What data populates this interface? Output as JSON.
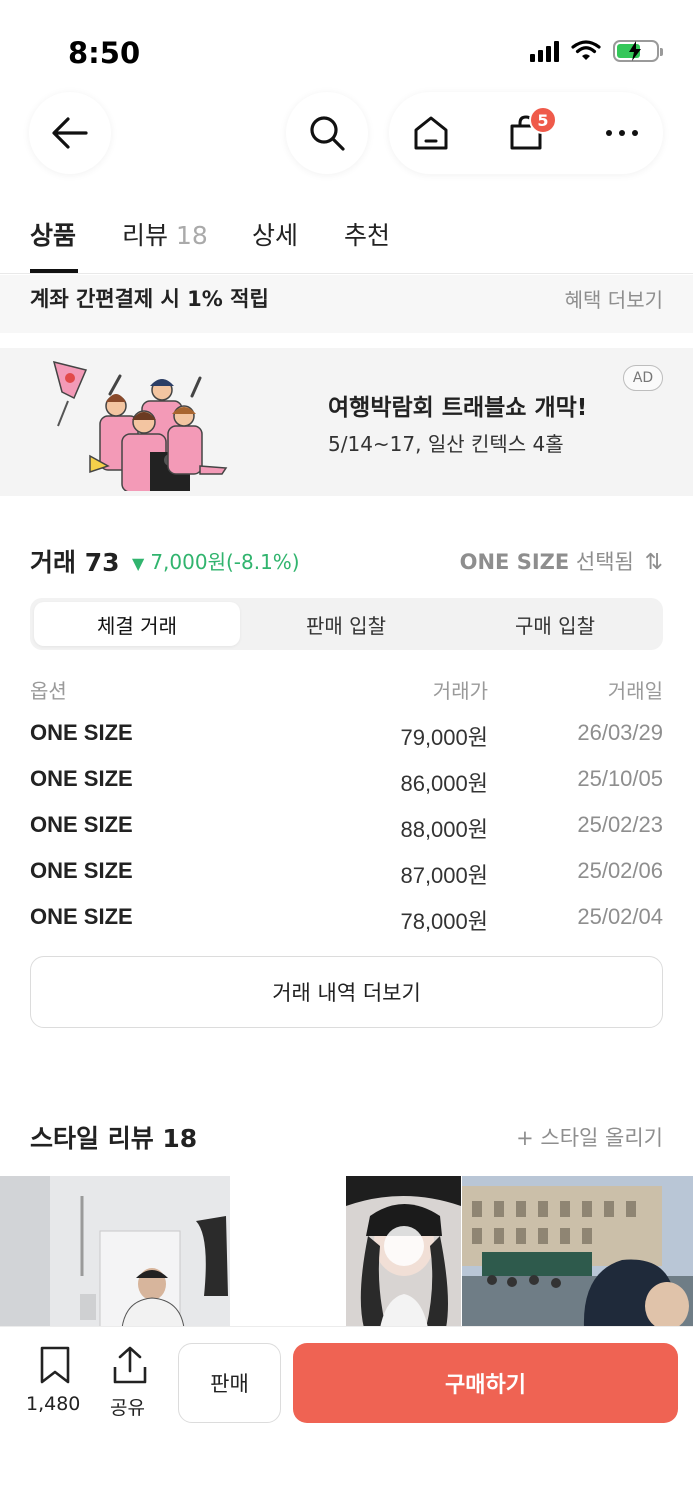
{
  "status_bar": {
    "time": "8:50"
  },
  "nav": {
    "cart_badge": "5"
  },
  "tabs": [
    {
      "label": "상품"
    },
    {
      "label": "리뷰",
      "count": "18"
    },
    {
      "label": "상세"
    },
    {
      "label": "추천"
    }
  ],
  "benefit": {
    "text": "계좌 간편결제 시 1% 적립",
    "more": "혜택 더보기"
  },
  "ad": {
    "title": "여행박람회 트래블쇼 개막!",
    "subtitle": "5/14~17, 일산 킨텍스 4홀",
    "tag": "AD"
  },
  "trades": {
    "title": "거래 73",
    "change": "7,000원(-8.1%)",
    "size_selected_size": "ONE SIZE",
    "size_selected_suffix": "선택됨",
    "segments": [
      "체결 거래",
      "판매 입찰",
      "구매 입찰"
    ],
    "headers": {
      "option": "옵션",
      "price": "거래가",
      "date": "거래일"
    },
    "rows": [
      {
        "option": "ONE SIZE",
        "price": "79,000원",
        "date": "26/03/29"
      },
      {
        "option": "ONE SIZE",
        "price": "86,000원",
        "date": "25/10/05"
      },
      {
        "option": "ONE SIZE",
        "price": "88,000원",
        "date": "25/02/23"
      },
      {
        "option": "ONE SIZE",
        "price": "87,000원",
        "date": "25/02/06"
      },
      {
        "option": "ONE SIZE",
        "price": "78,000원",
        "date": "25/02/04"
      }
    ],
    "more_label": "거래 내역 더보기"
  },
  "style_reviews": {
    "title": "스타일 리뷰 18",
    "upload": "+ 스타일 올리기"
  },
  "bottom_bar": {
    "bookmark_count": "1,480",
    "share_label": "공유",
    "sell_label": "판매",
    "buy_label": "구매하기"
  },
  "colors": {
    "accent": "#ef6353",
    "down": "#31b46e",
    "badge": "#ef5a4a"
  }
}
